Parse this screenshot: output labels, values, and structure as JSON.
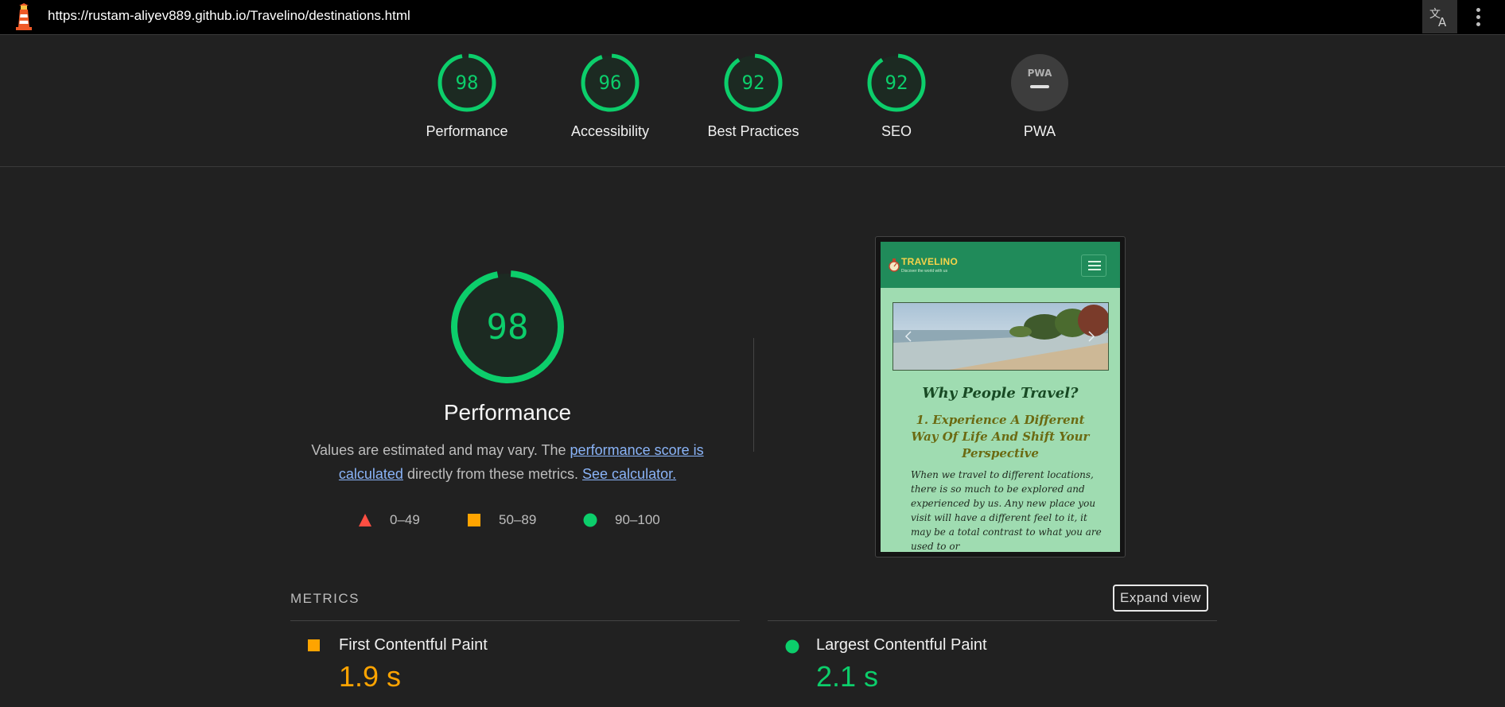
{
  "browser": {
    "url": "https://rustam-aliyev889.github.io/Travelino/destinations.html",
    "logo_icon": "lighthouse-icon",
    "translate_icon": "translate-icon",
    "menu_icon": "kebab-menu-icon"
  },
  "colors": {
    "pass": "#0cce6b",
    "average": "#ffa400",
    "fail": "#ff4e42",
    "na": "#b0b0b0"
  },
  "scores": [
    {
      "label": "Performance",
      "value": "98",
      "score": 98
    },
    {
      "label": "Accessibility",
      "value": "96",
      "score": 96
    },
    {
      "label": "Best Practices",
      "value": "92",
      "score": 92
    },
    {
      "label": "SEO",
      "value": "92",
      "score": 92
    },
    {
      "label": "PWA",
      "badge": "PWA"
    }
  ],
  "performance": {
    "score_text": "98",
    "score": 98,
    "title": "Performance",
    "desc_1": "Values are estimated and may vary. The ",
    "link_1": "performance score is calculated",
    "desc_2": " directly from these metrics. ",
    "link_2": "See calculator."
  },
  "legend": [
    {
      "range": "0–49",
      "shape": "triangle",
      "color": "#ff4e42"
    },
    {
      "range": "50–89",
      "shape": "square",
      "color": "#ffa400"
    },
    {
      "range": "90–100",
      "shape": "circle",
      "color": "#0cce6b"
    }
  ],
  "screenshot": {
    "brand": "TRAVELINO",
    "tagline": "Discover the world with us",
    "heading": "Why People Travel?",
    "subheading": "1. Experience A Different Way Of Life And Shift Your Perspective",
    "paragraph": "When we travel to different locations, there is so much to be explored and experienced by us. Any new place you visit will have a different feel to it, it may be a total contrast to what you are used to or"
  },
  "metrics": {
    "title": "METRICS",
    "expand_label": "Expand view",
    "items": [
      {
        "name": "First Contentful Paint",
        "value": "1.9 s",
        "rating": "average"
      },
      {
        "name": "Largest Contentful Paint",
        "value": "2.1 s",
        "rating": "pass"
      }
    ]
  }
}
